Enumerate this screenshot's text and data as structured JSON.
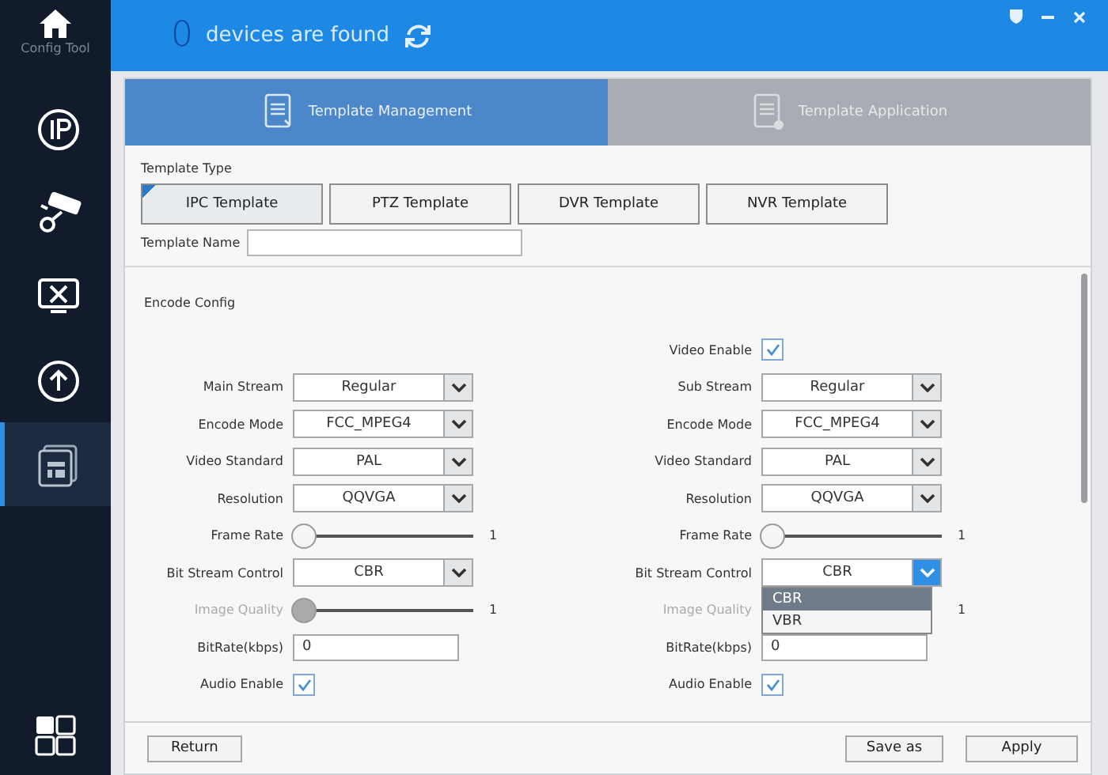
{
  "sidebar": {
    "app_name": "Config Tool",
    "items": [
      {
        "kind": "ip",
        "selected": false
      },
      {
        "kind": "camera",
        "selected": false
      },
      {
        "kind": "tools",
        "selected": false
      },
      {
        "kind": "upgrade",
        "selected": false
      },
      {
        "kind": "template",
        "selected": true
      }
    ]
  },
  "header": {
    "device_count": "0",
    "status_text": "devices are found"
  },
  "tabs": [
    {
      "label": "Template Management",
      "kind": "management",
      "selected": true
    },
    {
      "label": "Template Application",
      "kind": "application",
      "selected": false
    }
  ],
  "template_type": {
    "label": "Template Type",
    "options": [
      {
        "label": "IPC Template",
        "selected": true
      },
      {
        "label": "PTZ Template",
        "selected": false
      },
      {
        "label": "DVR Template",
        "selected": false
      },
      {
        "label": "NVR Template",
        "selected": false
      }
    ]
  },
  "template_name": {
    "label": "Template Name"
  },
  "section_title": "Encode Config",
  "columns": [
    {
      "fields": [
        {
          "kind": "spacer"
        },
        {
          "kind": "select",
          "label": "Main Stream",
          "value": "Regular",
          "expanded": false
        },
        {
          "kind": "select",
          "label": "Encode Mode",
          "value": "FCC_MPEG4",
          "expanded": false
        },
        {
          "kind": "select",
          "label": "Video Standard",
          "value": "PAL",
          "expanded": false
        },
        {
          "kind": "select",
          "label": "Resolution",
          "value": "QQVGA",
          "expanded": false
        },
        {
          "kind": "slider",
          "label": "Frame Rate",
          "level": 0,
          "reading": "1"
        },
        {
          "kind": "select",
          "label": "Bit Stream Control",
          "value": "CBR",
          "expanded": false
        },
        {
          "kind": "slider",
          "label": "Image Quality",
          "level": 0,
          "reading": "1",
          "disabled": true
        },
        {
          "kind": "text",
          "label": "BitRate(kbps)",
          "value": "0"
        },
        {
          "kind": "checkbox",
          "label": "Audio Enable",
          "checked": true
        }
      ]
    },
    {
      "fields": [
        {
          "kind": "checkbox",
          "label": "Video Enable",
          "checked": true
        },
        {
          "kind": "select",
          "label": "Sub Stream",
          "value": "Regular",
          "expanded": false
        },
        {
          "kind": "select",
          "label": "Encode Mode",
          "value": "FCC_MPEG4",
          "expanded": false
        },
        {
          "kind": "select",
          "label": "Video Standard",
          "value": "PAL",
          "expanded": false
        },
        {
          "kind": "select",
          "label": "Resolution",
          "value": "QQVGA",
          "expanded": false
        },
        {
          "kind": "slider",
          "label": "Frame Rate",
          "level": 0,
          "reading": "1"
        },
        {
          "kind": "select",
          "label": "Bit Stream Control",
          "value": "CBR",
          "expanded": true,
          "options": [
            {
              "label": "CBR",
              "selected": true
            },
            {
              "label": "VBR",
              "selected": false
            }
          ]
        },
        {
          "kind": "slider",
          "label": "Image Quality",
          "reading": "1",
          "disabled": true
        },
        {
          "kind": "text",
          "label": "BitRate(kbps)",
          "value": "0"
        },
        {
          "kind": "checkbox",
          "label": "Audio Enable",
          "checked": true
        }
      ]
    }
  ],
  "footer": {
    "left_buttons": [
      "Return"
    ],
    "right_buttons": [
      "Save as",
      "Apply"
    ]
  }
}
